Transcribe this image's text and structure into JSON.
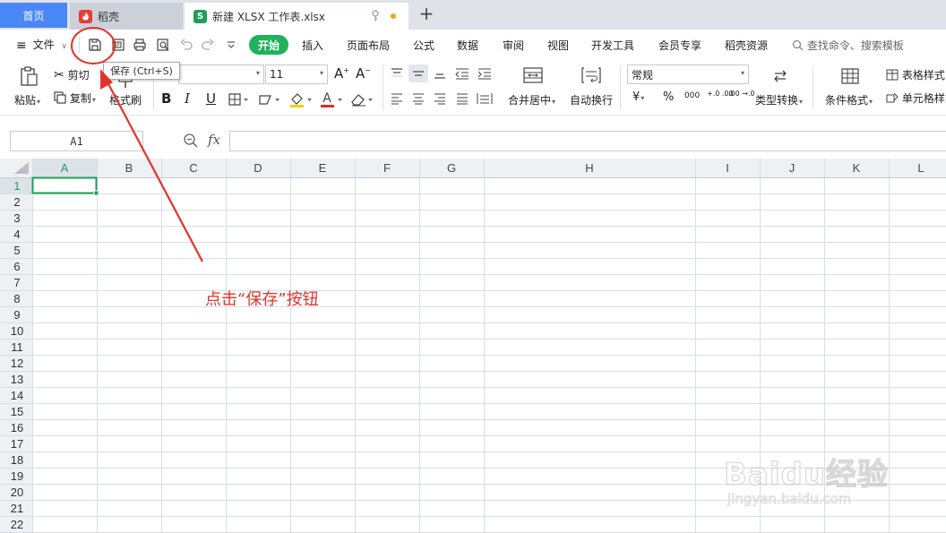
{
  "tabs": {
    "home": "首页",
    "docer": "稻壳",
    "document": "新建 XLSX 工作表.xlsx",
    "document_icon": "S",
    "add": "+"
  },
  "menu": {
    "file": "文件",
    "start": "开始",
    "items": [
      "插入",
      "页面布局",
      "公式",
      "数据",
      "审阅",
      "视图",
      "开发工具",
      "会员专享",
      "稻壳资源"
    ],
    "search": "查找命令、搜索模板"
  },
  "tooltip": "保存 (Ctrl+S)",
  "ribbon": {
    "paste": "粘贴",
    "cut": "剪切",
    "copy": "复制",
    "format_painter": "格式刷",
    "font_size": "11",
    "merge_center": "合并居中",
    "wrap_text": "自动换行",
    "number_format": "常规",
    "type_convert": "类型转换",
    "cond_format": "条件格式",
    "table_style": "表格样式",
    "cell_style": "单元格样式",
    "currency": "¥",
    "percent": "%",
    "thousands": "000",
    "inc_decimal": "+.0 .00",
    "dec_decimal": ".00 →.0"
  },
  "formula": {
    "name_box": "A1",
    "fx": "fx",
    "value": ""
  },
  "grid": {
    "columns": [
      "A",
      "B",
      "C",
      "D",
      "E",
      "F",
      "G",
      "H",
      "I",
      "J",
      "K",
      "L"
    ],
    "rows": [
      "1",
      "2",
      "3",
      "4",
      "5",
      "6",
      "7",
      "8",
      "9",
      "10",
      "11",
      "12",
      "13",
      "14",
      "15",
      "16",
      "17",
      "18",
      "19",
      "20",
      "21",
      "22"
    ],
    "active_cell": "A1",
    "accent": "#1f9f5b"
  },
  "annotation": {
    "text": "点击“保存”按钮",
    "color": "#e2332a"
  },
  "watermark": {
    "brand": "Baidu经验",
    "url": "jingyan.baidu.com"
  },
  "colors": {
    "home_tab": "#4a87f6",
    "start_button": "#1fb25a",
    "grid_line": "#d9dde5",
    "header_bg": "#eef0f4"
  }
}
